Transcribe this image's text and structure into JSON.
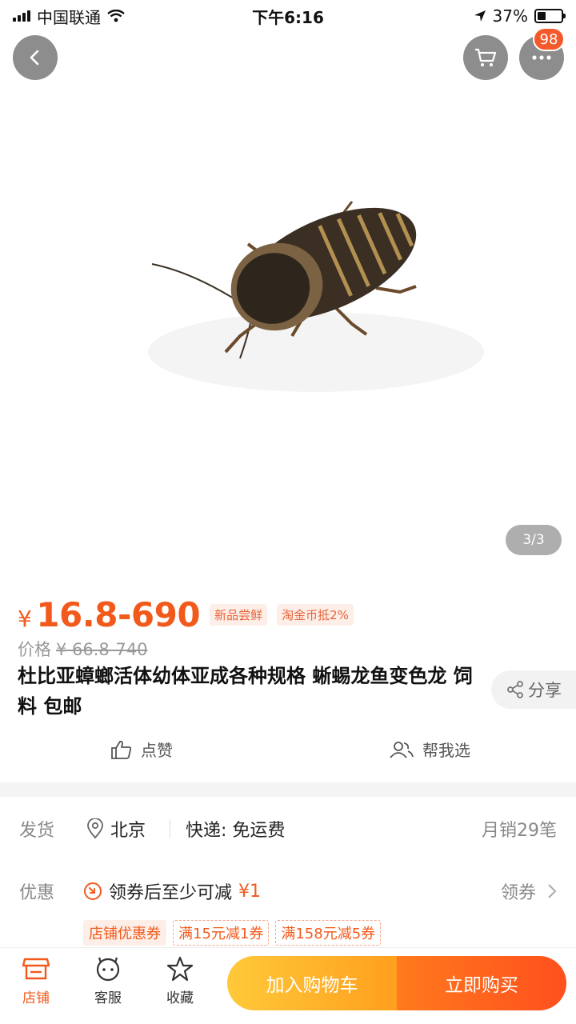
{
  "status_bar": {
    "carrier": "中国联通",
    "time": "下午6:16",
    "battery_text": "37%",
    "battery_level": 0.37
  },
  "header": {
    "back_icon": "chevron-left-icon",
    "cart_icon": "cart-icon",
    "more_icon": "more-dots-icon",
    "message_badge": "98"
  },
  "gallery": {
    "page_indicator": "3/3"
  },
  "product": {
    "currency": "¥",
    "price": "16.8-690",
    "tags": [
      "新品尝鲜",
      "淘金币抵2%"
    ],
    "original_label": "价格",
    "original_price": "¥ 66.8-740",
    "title": "杜比亚蟑螂活体幼体亚成各种规格 蜥蜴龙鱼变色龙 饲料 包邮",
    "share_label": "分享"
  },
  "actions": {
    "like_label": "点赞",
    "help_label": "帮我选"
  },
  "shipping": {
    "label": "发货",
    "location": "北京",
    "express": "快递: 免运费",
    "monthly_sales": "月销29笔"
  },
  "promotion": {
    "label": "优惠",
    "text": "领券后至少可减",
    "amount": "¥1",
    "link_label": "领券",
    "coupons": [
      "店铺优惠券",
      "满15元减1券",
      "满158元减5券"
    ]
  },
  "bottom_bar": {
    "shop_label": "店铺",
    "service_label": "客服",
    "favorite_label": "收藏",
    "add_cart_label": "加入购物车",
    "buy_now_label": "立即购买"
  },
  "colors": {
    "accent": "#f25a1c",
    "cart_button": "#ffb02a",
    "buy_button": "#ff5a1d"
  }
}
